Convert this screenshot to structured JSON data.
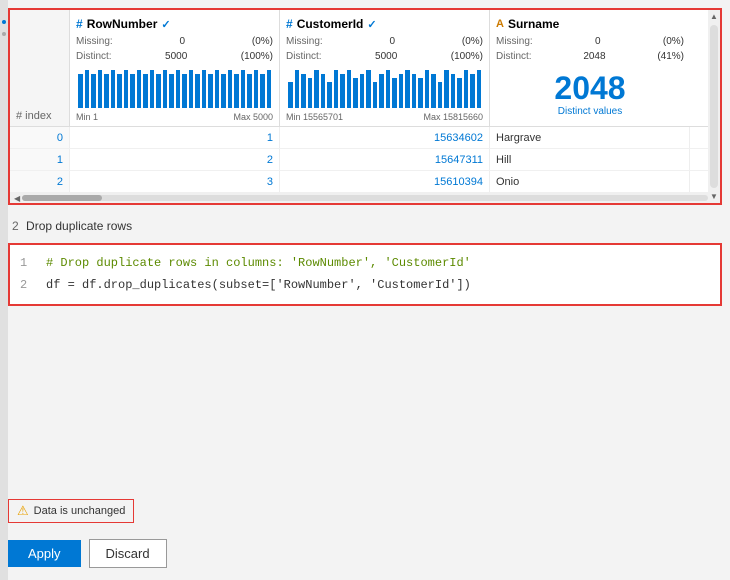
{
  "grid": {
    "columns": [
      {
        "id": "index",
        "label": "index",
        "type": "hash",
        "icon": "#"
      },
      {
        "id": "rownumber",
        "label": "RowNumber",
        "type": "numeric",
        "icon": "#",
        "check": true,
        "missing_count": "0",
        "missing_pct": "(0%)",
        "distinct_count": "5000",
        "distinct_pct": "(100%)",
        "min_label": "Min 1",
        "max_label": "Max 5000",
        "bars": [
          8,
          9,
          8,
          9,
          8,
          9,
          8,
          9,
          8,
          9,
          8,
          9,
          8,
          9,
          8,
          9,
          8,
          9,
          8,
          9,
          8,
          9,
          8,
          9,
          8,
          9,
          8,
          9,
          8,
          9
        ]
      },
      {
        "id": "customerid",
        "label": "CustomerId",
        "type": "numeric",
        "icon": "#",
        "check": true,
        "missing_count": "0",
        "missing_pct": "(0%)",
        "distinct_count": "5000",
        "distinct_pct": "(100%)",
        "min_label": "Min 15565701",
        "max_label": "Max 15815660",
        "bars": [
          6,
          9,
          8,
          7,
          9,
          8,
          6,
          9,
          8,
          9,
          7,
          8,
          9,
          6,
          8,
          9,
          7,
          8,
          9,
          8,
          7,
          9,
          8,
          6,
          9,
          8,
          7,
          9,
          8,
          9
        ]
      },
      {
        "id": "surname",
        "label": "Surname",
        "type": "text",
        "icon": "A",
        "icon_color": "#cc7a00",
        "missing_count": "0",
        "missing_pct": "(0%)",
        "distinct_count": "2048",
        "distinct_pct": "(41%)",
        "distinct_large": "2048",
        "distinct_large_label": "Distinct values"
      }
    ],
    "rows": [
      {
        "index": "0",
        "rownumber": "1",
        "customerid": "15634602",
        "surname": "Hargrave"
      },
      {
        "index": "1",
        "rownumber": "2",
        "customerid": "15647311",
        "surname": "Hill"
      },
      {
        "index": "2",
        "rownumber": "3",
        "customerid": "15610394",
        "surname": "Onio"
      }
    ]
  },
  "step": {
    "number": "2",
    "label": "Drop duplicate rows"
  },
  "code": {
    "line1_num": "1",
    "line1_text": "# Drop duplicate rows in columns: 'RowNumber', 'CustomerId'",
    "line2_num": "2",
    "line2_text": "df = df.drop_duplicates(subset=['RowNumber', 'CustomerId'])"
  },
  "status": {
    "icon": "⚠",
    "text": "Data is unchanged"
  },
  "buttons": {
    "apply_label": "Apply",
    "discard_label": "Discard"
  },
  "labels": {
    "missing": "Missing:",
    "distinct": "Distinct:",
    "index_header": "# index"
  }
}
